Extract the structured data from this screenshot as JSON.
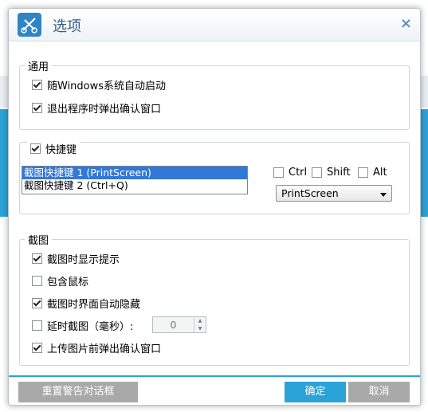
{
  "dialog": {
    "title": "选项",
    "close_glyph": "×"
  },
  "general": {
    "legend": "通用",
    "items": [
      {
        "label": "随Windows系统自动启动",
        "checked": true
      },
      {
        "label": "退出程序时弹出确认窗口",
        "checked": true
      }
    ]
  },
  "hotkey": {
    "legend": "快捷键",
    "checked": true,
    "list": [
      {
        "label": "截图快捷键 1 (PrintScreen)",
        "selected": true
      },
      {
        "label": "截图快捷键 2 (Ctrl+Q)",
        "selected": false
      }
    ],
    "modifiers": {
      "ctrl": "Ctrl",
      "shift": "Shift",
      "alt": "Alt"
    },
    "key_select": "PrintScreen"
  },
  "screenshot": {
    "legend": "截图",
    "items": [
      {
        "label": "截图时显示提示",
        "checked": true
      },
      {
        "label": "包含鼠标",
        "checked": false
      },
      {
        "label": "截图时界面自动隐藏",
        "checked": true
      },
      {
        "label": "延时截图（毫秒）:",
        "checked": false
      },
      {
        "label": "上传图片前弹出确认窗口",
        "checked": true
      }
    ],
    "delay_value": "0"
  },
  "footer": {
    "reset_label": "重置警告对话框",
    "ok_label": "确定",
    "cancel_label": "取消"
  },
  "colors": {
    "accent": "#2aa3d8",
    "title": "#355f86",
    "selection": "#3278d6"
  },
  "icons": {
    "app": "scissors-logo-icon",
    "close": "close-icon",
    "dropdown": "chevron-down-icon"
  }
}
